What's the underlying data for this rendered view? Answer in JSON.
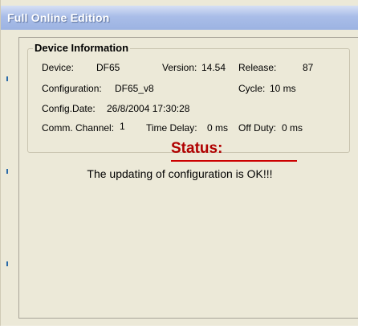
{
  "window": {
    "title": "Full Online Edition"
  },
  "device_info": {
    "legend": "Device Information",
    "device_label": "Device:",
    "device_value": "DF65",
    "version_label": "Version:",
    "version_value": "14.54",
    "release_label": "Release:",
    "release_value": "87",
    "configuration_label": "Configuration:",
    "configuration_value": "DF65_v8",
    "cycle_label": "Cycle:",
    "cycle_value": "10 ms",
    "config_date_label": "Config.Date:",
    "config_date_value": "26/8/2004 17:30:28",
    "comm_channel_label": "Comm. Channel:",
    "comm_channel_value": "1",
    "time_delay_label": "Time Delay:",
    "time_delay_value": "0 ms",
    "off_duty_label": "Off Duty:",
    "off_duty_value": "0 ms"
  },
  "status": {
    "title": "Status:",
    "message": "The updating of configuration is OK!!!"
  },
  "colors": {
    "status_title": "#b00000",
    "status_line": "#cc0000",
    "window_bg": "#ece9d8"
  }
}
